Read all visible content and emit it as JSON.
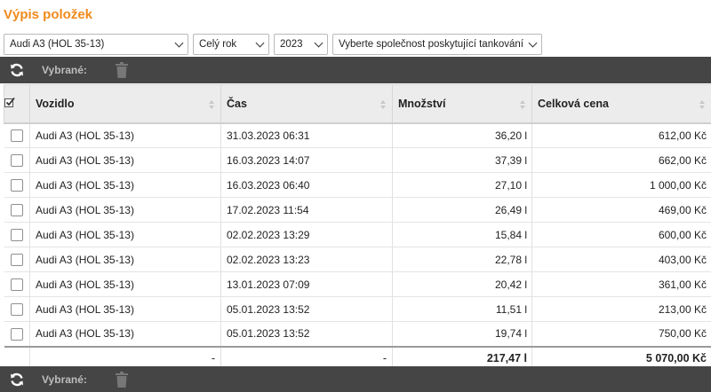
{
  "page": {
    "title": "Výpis položek"
  },
  "filters": {
    "vehicle": "Audi A3 (HOL 35-13)",
    "period": "Celý rok",
    "year": "2023",
    "company": "Vyberte společnost poskytující tankování"
  },
  "toolbar": {
    "selected_label": "Vybrané:",
    "refresh_icon": "refresh-icon",
    "trash_icon": "trash-icon"
  },
  "table": {
    "columns": [
      "Vozidlo",
      "Čas",
      "Množství",
      "Celková cena"
    ],
    "rows": [
      {
        "vehicle": "Audi A3 (HOL 35-13)",
        "time": "31.03.2023 06:31",
        "amount": "36,20 l",
        "price": "612,00 Kč"
      },
      {
        "vehicle": "Audi A3 (HOL 35-13)",
        "time": "16.03.2023 14:07",
        "amount": "37,39 l",
        "price": "662,00 Kč"
      },
      {
        "vehicle": "Audi A3 (HOL 35-13)",
        "time": "16.03.2023 06:40",
        "amount": "27,10 l",
        "price": "1 000,00 Kč"
      },
      {
        "vehicle": "Audi A3 (HOL 35-13)",
        "time": "17.02.2023 11:54",
        "amount": "26,49 l",
        "price": "469,00 Kč"
      },
      {
        "vehicle": "Audi A3 (HOL 35-13)",
        "time": "02.02.2023 13:29",
        "amount": "15,84 l",
        "price": "600,00 Kč"
      },
      {
        "vehicle": "Audi A3 (HOL 35-13)",
        "time": "02.02.2023 13:23",
        "amount": "22,78 l",
        "price": "403,00 Kč"
      },
      {
        "vehicle": "Audi A3 (HOL 35-13)",
        "time": "13.01.2023 07:09",
        "amount": "20,42 l",
        "price": "361,00 Kč"
      },
      {
        "vehicle": "Audi A3 (HOL 35-13)",
        "time": "05.01.2023 13:52",
        "amount": "11,51 l",
        "price": "213,00 Kč"
      },
      {
        "vehicle": "Audi A3 (HOL 35-13)",
        "time": "05.01.2023 13:52",
        "amount": "19,74 l",
        "price": "750,00 Kč"
      }
    ],
    "totals": {
      "vehicle": "-",
      "time": "-",
      "amount": "217,47 l",
      "price": "5 070,00 Kč"
    }
  },
  "colors": {
    "title": "#f08a1c",
    "toolbar": "#454545",
    "header": "#ececec"
  }
}
